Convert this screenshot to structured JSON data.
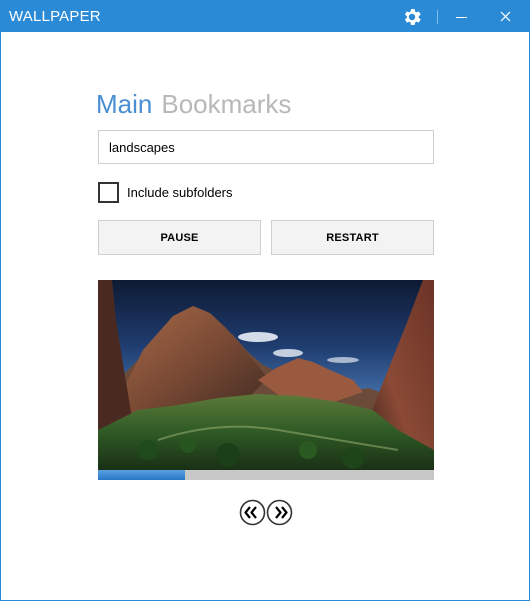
{
  "window": {
    "title": "WALLPAPER"
  },
  "titlebar": {
    "settings_icon": "gear-icon",
    "minimize_icon": "minimize-icon",
    "close_icon": "close-icon"
  },
  "tabs": [
    {
      "label": "Main",
      "active": true
    },
    {
      "label": "Bookmarks",
      "active": false
    }
  ],
  "search": {
    "value": "landscapes"
  },
  "options": {
    "include_subfolders_label": "Include subfolders",
    "include_subfolders_checked": false
  },
  "buttons": {
    "pause_label": "PAUSE",
    "restart_label": "RESTART"
  },
  "preview": {
    "image_icon": "landscape-image"
  },
  "progress": {
    "value": 0.26
  },
  "navigation": {
    "prev_icon": "double-chevron-left-icon",
    "next_icon": "double-chevron-right-icon"
  },
  "colors": {
    "accent": "#2b8ad6",
    "tab_active": "#4a8fd4",
    "tab_inactive": "#b8b8b8",
    "progress_fill": "#2a77c7",
    "progress_track": "#c8c8c8"
  }
}
